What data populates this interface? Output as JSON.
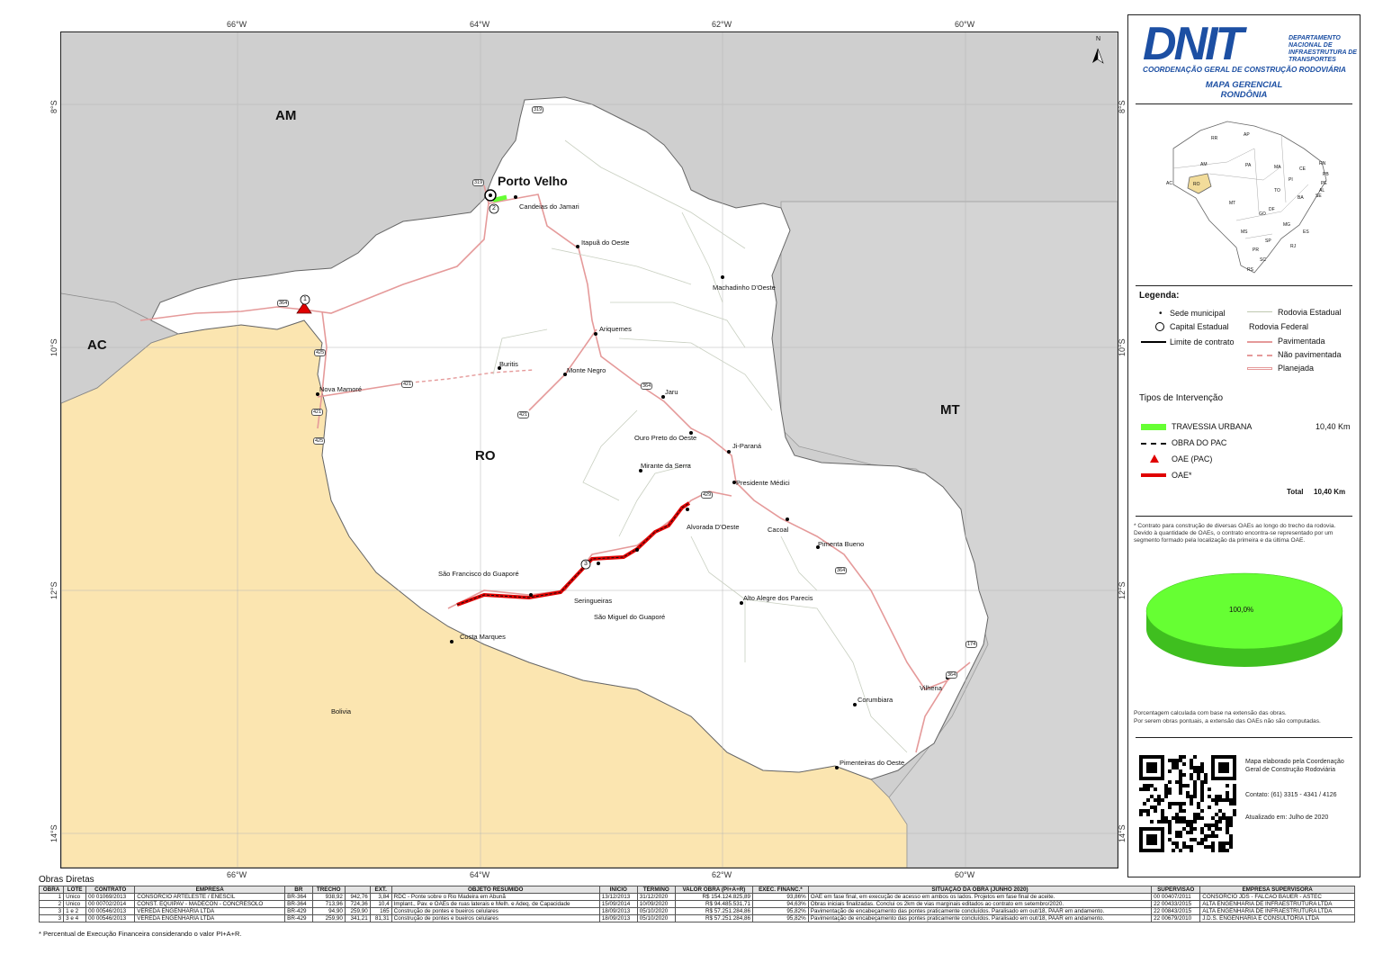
{
  "header": {
    "logo": "DNIT",
    "agency": "DEPARTAMENTO NACIONAL DE INFRAESTRUTURA DE TRANSPORTES",
    "coordination": "COORDENAÇÃO GERAL DE CONSTRUÇÃO RODOVIÁRIA",
    "map_title": "MAPA GERENCIAL",
    "map_subtitle": "RONDÔNIA",
    "north": "N"
  },
  "map": {
    "states": {
      "am": "AM",
      "ac": "AC",
      "ro": "RO",
      "mt": "MT",
      "bolivia": "Bolivia"
    },
    "capital": "Porto Velho",
    "cities": [
      "Candeias do Jamari",
      "Itapuã do Oeste",
      "Machadinho D'Oeste",
      "Ariquemes",
      "Buritis",
      "Monte Negro",
      "Nova Mamoré",
      "Jaru",
      "Ouro Preto do Oeste",
      "Ji-Paraná",
      "Mirante da Serra",
      "Presidente Médici",
      "Alvorada D'Oeste",
      "Cacoal",
      "Pimenta Bueno",
      "São Francisco do Guaporé",
      "Seringueiras",
      "São Miguel do Guaporé",
      "Alto Alegre dos Parecis",
      "Costa Marques",
      "Vilhena",
      "Corumbiara",
      "Pimenteiras do Oeste"
    ],
    "coords_top": [
      "66°W",
      "64°W",
      "62°W",
      "60°W"
    ],
    "coords_bottom": [
      "66°W",
      "64°W",
      "62°W",
      "60°W"
    ],
    "coords_left": [
      "8°S",
      "10°S",
      "12°S",
      "14°S"
    ],
    "coords_right": [
      "8°S",
      "10°S",
      "12°S",
      "14°S"
    ],
    "road_shields": [
      "319",
      "319",
      "364",
      "425",
      "421",
      "421",
      "421",
      "364",
      "429",
      "364",
      "174",
      "364",
      "425",
      "425"
    ],
    "markers": [
      "1",
      "2",
      "3"
    ],
    "scale": {
      "unit": "Km",
      "ticks": [
        "0",
        "30",
        "60",
        "120"
      ]
    }
  },
  "minimap": {
    "states": [
      "RR",
      "AP",
      "AM",
      "PA",
      "MA",
      "CE",
      "RN",
      "PB",
      "PE",
      "AL",
      "SE",
      "PI",
      "TO",
      "BA",
      "AC",
      "RO",
      "MT",
      "GO",
      "DF",
      "MG",
      "ES",
      "MS",
      "SP",
      "RJ",
      "PR",
      "SC",
      "RS"
    ],
    "highlight_color": "#f2dc9a"
  },
  "legend": {
    "title": "Legenda:",
    "sede": "Sede municipal",
    "capital": "Capital Estadual",
    "limite": "Limite de contrato",
    "rod_estadual": "Rodovia Estadual",
    "rod_federal": "Rodovia Federal",
    "pavimentada": "Pavimentada",
    "nao_pavimentada": "Não pavimentada",
    "planejada": "Planejada"
  },
  "tipos": {
    "title": "Tipos de Intervenção",
    "items": [
      {
        "label": "TRAVESSIA URBANA",
        "value": "10,40 Km",
        "color": "#66ff33"
      },
      {
        "label": "OBRA DO PAC",
        "value": ""
      },
      {
        "label": "OAE (PAC)",
        "value": "",
        "color": "#e00000"
      },
      {
        "label": "OAE*",
        "value": "",
        "color": "#e00000"
      }
    ],
    "total_label": "Total",
    "total_value": "10,40 Km"
  },
  "notes": {
    "contract": "* Contrato para construção de diversas OAEs ao longo do trecho da rodovia. Devido à quantidade de OAEs, o contrato encontra-se representado por um segmento formado pela localização da primeira e da última OAE.",
    "percent": "Porcentagem calculada com base na extensão das obras.",
    "oae": "Por serem obras pontuais, a extensão das OAEs não são computadas."
  },
  "chart_data": {
    "type": "pie",
    "categories": [
      "TRAVESSIA URBANA"
    ],
    "values": [
      100
    ],
    "labels": [
      "100,0%"
    ],
    "colors": [
      "#66ff33"
    ]
  },
  "footer": {
    "elaborated": "Mapa elaborado pela Coordenação Geral de Construção Rodoviária",
    "contact": "Contato: (61) 3315 - 4341 / 4126",
    "updated": "Atualizado em: Julho de 2020"
  },
  "obras": {
    "title": "Obras Diretas",
    "headers": [
      "OBRA",
      "LOTE",
      "CONTRATO",
      "EMPRESA",
      "BR",
      "TRECHO",
      "",
      "EXT.",
      "OBJETO RESUMIDO",
      "INÍCIO",
      "TÉRMINO",
      "VALOR OBRA (PI+A+R)",
      "EXEC. FINANC.*",
      "SITUAÇÃO DA OBRA (JUNHO 2020)",
      "SUPERVISÃO",
      "EMPRESA SUPERVISORA"
    ],
    "rows": [
      [
        "1",
        "Único",
        "00 01069/2013",
        "CONSÓRCIO ARTELESTE / ENESCIL",
        "BR-364",
        "938,92",
        "942,76",
        "3,84",
        "RDC - Ponte sobre o Rio Madeira em Abunã",
        "13/12/2013",
        "31/12/2020",
        "R$ 154.124.825,89",
        "93,86%",
        "OAE em fase final, em execução de acesso em ambos os lados. Projetos em fase final de aceite.",
        "00 00407/2011",
        "CONSÓRCIO JDS - FALCÃO BAUER - ASTEC"
      ],
      [
        "2",
        "Único",
        "00 00702/2014",
        "CONST. EQUIPAV - MADECON - CONCRESOLO",
        "BR-364",
        "713,96",
        "724,36",
        "10,4",
        "Implant., Pav. e OAEs de ruas laterais e Melh. e Adeq. de Capacidade",
        "15/09/2014",
        "10/09/2020",
        "R$ 94.485.531,71",
        "94,63%",
        "Obras iniciais finalizadas. Conclui os 2km de vias marginais editados ao contrato em setembro/2020.",
        "22 00433/2015",
        "ALTA ENGENHARIA DE INFRAESTRUTURA LTDA"
      ],
      [
        "3",
        "1 e 2",
        "00 00546/2013",
        "VEREDA ENGENHARIA LTDA",
        "BR-429",
        "94,90",
        "259,90",
        "165",
        "Construção de pontes e bueiros celulares",
        "18/09/2013",
        "05/10/2020",
        "R$ 57.251.284,86",
        "95,82%",
        "Pavimentação de encabeçamento das pontes praticamente concluídos. Paralisado em out/18, PAAR em andamento.",
        "22 00843/2015",
        "ALTA ENGENHARIA DE INFRAESTRUTURA LTDA"
      ],
      [
        "3",
        "3 e 4",
        "00 00546/2013",
        "VEREDA ENGENHARIA LTDA",
        "BR-429",
        "259,90",
        "341,21",
        "81,31",
        "Construção de pontes e bueiros celulares",
        "18/09/2013",
        "05/10/2020",
        "R$ 57.251.284,86",
        "95,82%",
        "Pavimentação de encabeçamento das pontes praticamente concluídos. Paralisado em out/18, PAAR em andamento.",
        "22 00679/2010",
        "J.D.S. ENGENHARIA E CONSULTORIA LTDA"
      ]
    ],
    "footnote": "* Percentual de Execução Financeira considerando o valor PI+A+R."
  }
}
